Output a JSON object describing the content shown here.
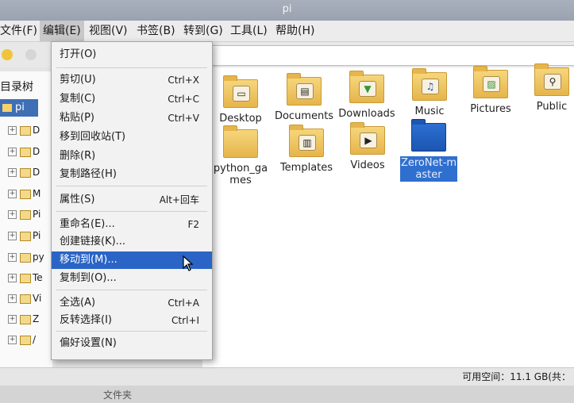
{
  "window": {
    "title": "pi"
  },
  "menubar": [
    "文件(F)",
    "编辑(E)",
    "视图(V)",
    "书签(B)",
    "转到(G)",
    "工具(L)",
    "帮助(H)"
  ],
  "sidebar": {
    "title": "目录树",
    "selected": "pi",
    "rows": [
      "D",
      "D",
      "D",
      "M",
      "Pi",
      "Pi",
      "py",
      "Te",
      "Vi",
      "Z",
      "/"
    ]
  },
  "edit_menu": {
    "items": [
      {
        "label": "打开(O)",
        "shortcut": ""
      },
      {
        "label": "剪切(U)",
        "shortcut": "Ctrl+X"
      },
      {
        "label": "复制(C)",
        "shortcut": "Ctrl+C"
      },
      {
        "label": "粘贴(P)",
        "shortcut": "Ctrl+V"
      },
      {
        "label": "移到回收站(T)",
        "shortcut": ""
      },
      {
        "label": "删除(R)",
        "shortcut": ""
      },
      {
        "label": "复制路径(H)",
        "shortcut": ""
      },
      {
        "label": "属性(S)",
        "shortcut": "Alt+回车"
      },
      {
        "label": "重命名(E)...",
        "shortcut": "F2"
      },
      {
        "label": "创建链接(K)...",
        "shortcut": ""
      },
      {
        "label": "移动到(M)...",
        "shortcut": ""
      },
      {
        "label": "复制到(O)...",
        "shortcut": ""
      },
      {
        "label": "全选(A)",
        "shortcut": "Ctrl+A"
      },
      {
        "label": "反转选择(I)",
        "shortcut": "Ctrl+I"
      },
      {
        "label": "偏好设置(N)",
        "shortcut": ""
      }
    ]
  },
  "files": [
    {
      "name": "Desktop",
      "icon": "desktop-folder-icon",
      "badge": "▭"
    },
    {
      "name": "Documents",
      "icon": "documents-folder-icon",
      "badge": "▤"
    },
    {
      "name": "Downloads",
      "icon": "downloads-folder-icon",
      "badge": "▼"
    },
    {
      "name": "Music",
      "icon": "music-folder-icon",
      "badge": "♫"
    },
    {
      "name": "Pictures",
      "icon": "pictures-folder-icon",
      "badge": "▨"
    },
    {
      "name": "Public",
      "icon": "public-folder-icon",
      "badge": "⚲"
    },
    {
      "name": "python_games",
      "icon": "folder-icon",
      "badge": ""
    },
    {
      "name": "Templates",
      "icon": "templates-folder-icon",
      "badge": "▥"
    },
    {
      "name": "Videos",
      "icon": "videos-folder-icon",
      "badge": "▶"
    },
    {
      "name": "ZeroNet-master",
      "icon": "folder-icon",
      "badge": ""
    }
  ],
  "status": {
    "free_space": "可用空间：11.1 GB(共："
  },
  "bottom": {
    "text": "文件夹"
  }
}
